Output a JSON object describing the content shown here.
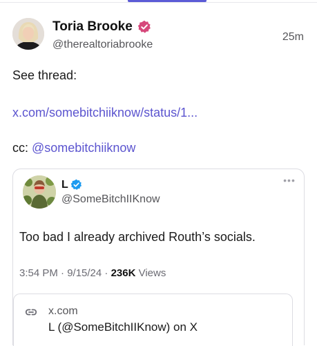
{
  "post": {
    "author_name": "Toria Brooke",
    "author_handle": "@therealtoriabrooke",
    "timestamp": "25m",
    "line1": "See thread:",
    "thread_link": "x.com/somebitchiiknow/status/1...",
    "cc_prefix": "cc: ",
    "cc_mention": "@somebitchiiknow"
  },
  "embed": {
    "author_name": "L",
    "author_handle": "@SomeBitchIIKnow",
    "text": "Too bad I already archived Routh’s socials.",
    "meta_time": "3:54 PM · 9/15/24 · ",
    "meta_views_count": "236K",
    "meta_views_label": " Views",
    "more_icon": "•••",
    "link_card": {
      "domain": "x.com",
      "title": "L (@SomeBitchIIKnow) on X"
    }
  },
  "colors": {
    "accent": "#5b5bd6",
    "link": "#5b54cf",
    "verified_main": "#d6487b",
    "verified_embed": "#1d9bf0"
  },
  "icons": {
    "verified_main": "verified-badge-icon",
    "verified_embed": "verified-check-icon",
    "more": "more-horizontal-icon",
    "link": "link-icon"
  }
}
